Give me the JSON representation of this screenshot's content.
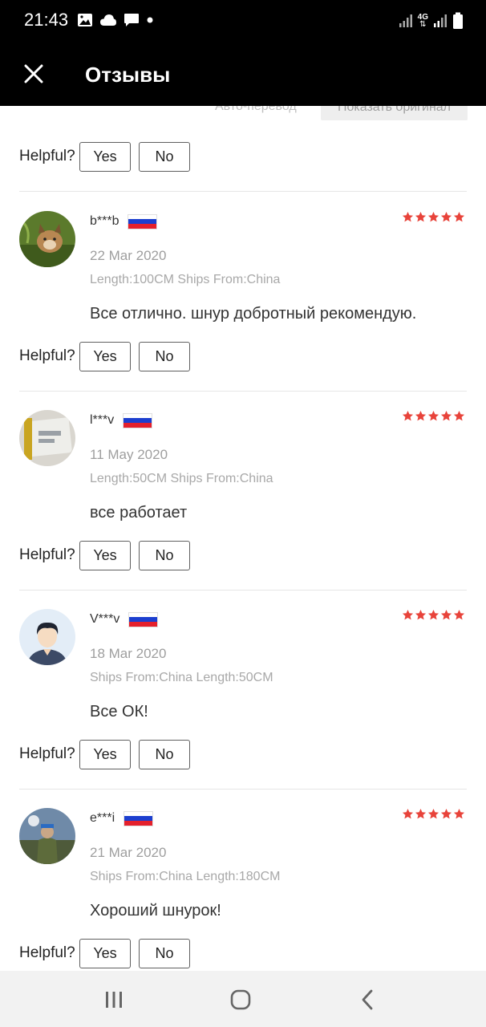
{
  "status": {
    "time": "21:43",
    "network": "4G"
  },
  "appbar": {
    "title": "Отзывы"
  },
  "translate": {
    "auto_label": "Авто-перевод",
    "original_label": "Показать оригинал"
  },
  "helpful": {
    "label": "Helpful?",
    "yes": "Yes",
    "no": "No"
  },
  "colors": {
    "star": "#e8433a",
    "flag_white": "#ffffff",
    "flag_blue": "#1c3fcf",
    "flag_red": "#e4202c"
  },
  "reviews": [
    {
      "user": "b***b",
      "rating": 5,
      "date": "22 Mar 2020",
      "attrs": "Length:100CM Ships From:China",
      "text": "Все отлично. шнур добротный рекомендую.",
      "avatar_icon": "lynx-photo-avatar"
    },
    {
      "user": "l***v",
      "rating": 5,
      "date": "11 May 2020",
      "attrs": "Length:50CM Ships From:China",
      "text": "все работает",
      "avatar_icon": "package-photo-avatar"
    },
    {
      "user": "V***v",
      "rating": 5,
      "date": "18 Mar 2020",
      "attrs": "Ships From:China Length:50CM",
      "text": "Все ОК!",
      "avatar_icon": "default-person-avatar"
    },
    {
      "user": "e***i",
      "rating": 5,
      "date": "21 Mar 2020",
      "attrs": "Ships From:China Length:180CM",
      "text": "Хороший шнурок!",
      "avatar_icon": "soldier-photo-avatar"
    }
  ]
}
